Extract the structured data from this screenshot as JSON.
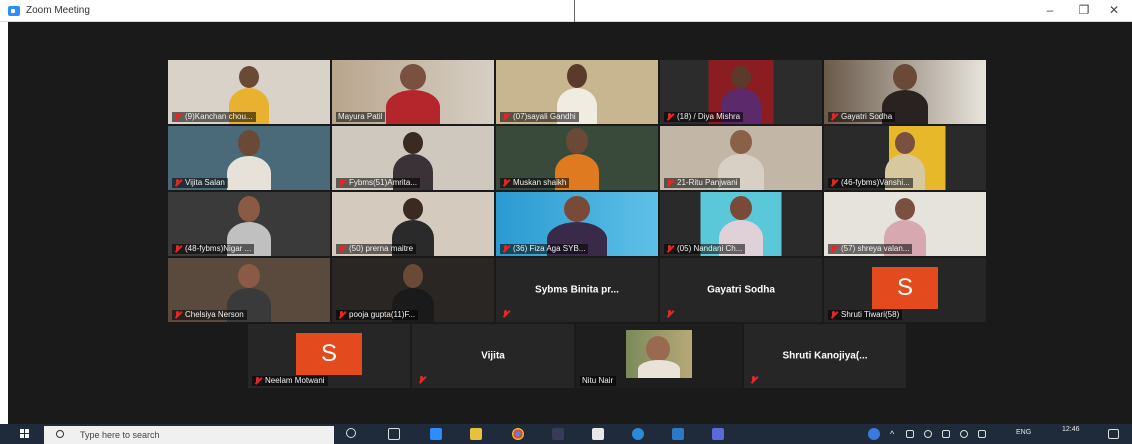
{
  "window": {
    "title": "Zoom Meeting",
    "minimize_glyph": "–",
    "restore_glyph": "❐",
    "close_glyph": "✕"
  },
  "participants": {
    "row1": [
      {
        "name": "(9)Kanchan chou..."
      },
      {
        "name": "Mayura Patil"
      },
      {
        "name": "(07)sayali Gandhi"
      },
      {
        "name": "(18) / Diya Mishra"
      },
      {
        "name": "Gayatri Sodha"
      }
    ],
    "row2": [
      {
        "name": "Vijita Salan"
      },
      {
        "name": "Fybms(51)Amrita..."
      },
      {
        "name": "Muskan shaikh"
      },
      {
        "name": "21-Ritu Panjwani"
      },
      {
        "name": "(46-fybms)Vanshi..."
      }
    ],
    "row3": [
      {
        "name": "(48-fybms)Nigar ..."
      },
      {
        "name": "(50) prerna maitre"
      },
      {
        "name": "(36) Fiza Aga SYB..."
      },
      {
        "name": "(05) Nandani Ch..."
      },
      {
        "name": "(57) shreya valan..."
      }
    ],
    "row4": [
      {
        "name": "Chelsiya Nerson"
      },
      {
        "name": "pooja gupta(11)F..."
      },
      {
        "name": "Sybms Binita pr..."
      },
      {
        "name": "Gayatri Sodha"
      },
      {
        "name": "Shruti Tiwari(58)",
        "avatar_letter": "S"
      }
    ],
    "row5": [
      {
        "name": "Neelam Motwani",
        "avatar_letter": "S"
      },
      {
        "name": "Vijita"
      },
      {
        "name": "Nitu Nair"
      },
      {
        "name": "Shruti Kanojiya(..."
      }
    ]
  },
  "taskbar": {
    "search_placeholder": "Type here to search",
    "language": "ENG",
    "time": "12:46"
  },
  "colors": {
    "meeting_bg": "#1a1a1a",
    "active_speaker": "#c8dc3c",
    "avatar": "#e34b1e",
    "muted": "#e02828",
    "taskbar": "#1f2a3a"
  }
}
